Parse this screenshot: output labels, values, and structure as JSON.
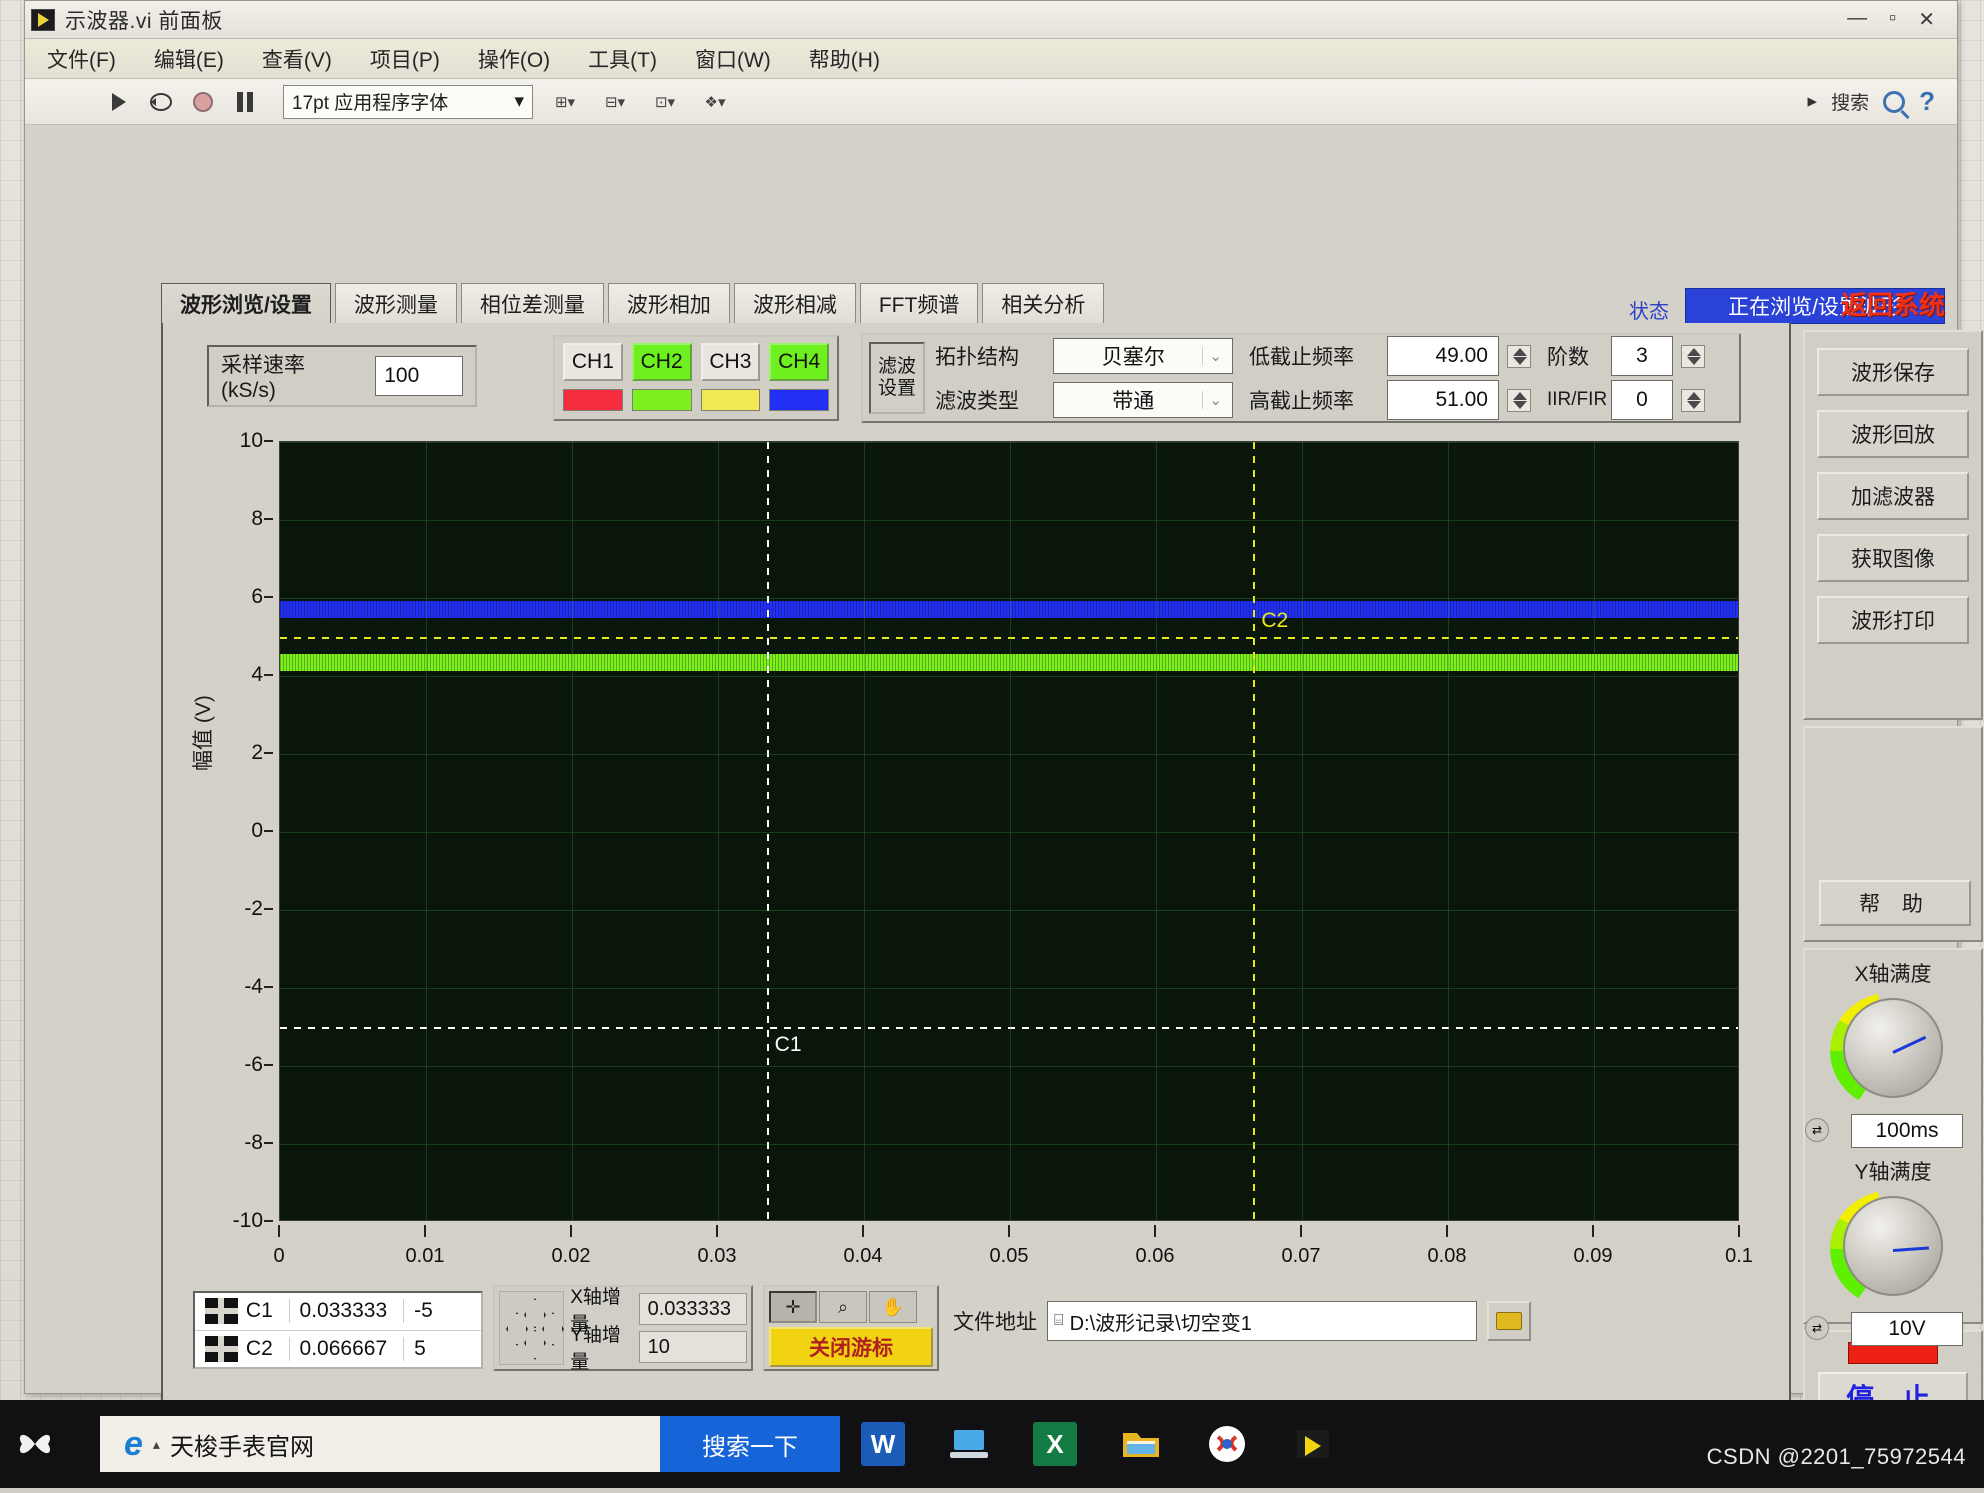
{
  "window": {
    "title": "示波器.vi 前面板",
    "controls": {
      "minimize": "—",
      "maximize": "▫",
      "close": "✕"
    }
  },
  "menu": [
    "文件(F)",
    "编辑(E)",
    "查看(V)",
    "项目(P)",
    "操作(O)",
    "工具(T)",
    "窗口(W)",
    "帮助(H)"
  ],
  "toolbar": {
    "font_selector": "17pt 应用程序字体",
    "search_placeholder": "搜索"
  },
  "tabs": [
    {
      "label": "波形浏览/设置",
      "active": true
    },
    {
      "label": "波形测量",
      "active": false
    },
    {
      "label": "相位差测量",
      "active": false
    },
    {
      "label": "波形相加",
      "active": false
    },
    {
      "label": "波形相减",
      "active": false
    },
    {
      "label": "FFT频谱",
      "active": false
    },
    {
      "label": "相关分析",
      "active": false
    }
  ],
  "status": {
    "label": "状态",
    "value": "正在浏览/设置波形",
    "color": "#2b42d8"
  },
  "sample_rate": {
    "label": "采样速率 (kS/s)",
    "value": "100"
  },
  "channels": {
    "buttons": [
      {
        "label": "CH1",
        "active": false,
        "color": "#f52b3e"
      },
      {
        "label": "CH2",
        "active": true,
        "color": "#7cf01c"
      },
      {
        "label": "CH3",
        "active": false,
        "color": "#f2ea52"
      },
      {
        "label": "CH4",
        "active": true,
        "color": "#2230f5"
      }
    ]
  },
  "filter": {
    "tag_line1": "滤波",
    "tag_line2": "设置",
    "topology_label": "拓扑结构",
    "topology_value": "贝塞尔",
    "type_label": "滤波类型",
    "type_value": "带通",
    "low_cut_label": "低截止频率",
    "low_cut_value": "49.00",
    "high_cut_label": "高截止频率",
    "high_cut_value": "51.00",
    "order_label": "阶数",
    "order_value": "3",
    "iirfir_label": "IIR/FIR",
    "iirfir_value": "0"
  },
  "chart_data": {
    "type": "line",
    "title": "",
    "xlabel": "",
    "ylabel": "幅值 (V)",
    "x": [
      0,
      0.01,
      0.02,
      0.03,
      0.04,
      0.05,
      0.06,
      0.07,
      0.08,
      0.09,
      0.1
    ],
    "xticks": [
      "0",
      "0.01",
      "0.02",
      "0.03",
      "0.04",
      "0.05",
      "0.06",
      "0.07",
      "0.08",
      "0.09",
      "0.1"
    ],
    "yticks": [
      "10",
      "8",
      "6",
      "4",
      "2",
      "0",
      "-2",
      "-4",
      "-6",
      "-8",
      "-10"
    ],
    "xlim": [
      0,
      0.1
    ],
    "ylim": [
      -10,
      10
    ],
    "grid": true,
    "background": "#0b160b",
    "series": [
      {
        "name": "CH4",
        "color": "#2230f5",
        "mean": 5.7,
        "noise_band": 0.45,
        "values": [
          5.7,
          5.7,
          5.7,
          5.7,
          5.7,
          5.7,
          5.7,
          5.7,
          5.7,
          5.7,
          5.7
        ]
      },
      {
        "name": "CH2",
        "color": "#7cf01c",
        "mean": 4.35,
        "noise_band": 0.45,
        "values": [
          4.35,
          4.35,
          4.35,
          4.35,
          4.35,
          4.35,
          4.35,
          4.35,
          4.35,
          4.35,
          4.35
        ]
      }
    ],
    "cursors": [
      {
        "name": "C1",
        "x": 0.033333,
        "y": -5,
        "color": "#ffffff"
      },
      {
        "name": "C2",
        "x": 0.066667,
        "y": 5,
        "color": "#e8e81e"
      }
    ]
  },
  "cursor_table": {
    "rows": [
      {
        "name": "C1",
        "x": "0.033333",
        "y": "-5"
      },
      {
        "name": "C2",
        "x": "0.066667",
        "y": "5"
      }
    ]
  },
  "increments": {
    "x_label": "X轴增量",
    "x_value": "0.033333",
    "y_label": "Y轴增量",
    "y_value": "10"
  },
  "graph_palette": {
    "icons": [
      "cursor-crosshair-icon",
      "zoom-icon",
      "pan-hand-icon"
    ],
    "toggle_label": "关闭游标"
  },
  "file": {
    "label": "文件地址",
    "path": "D:\\波形记录\\切空变1"
  },
  "sidebar": {
    "title": "返回系统",
    "buttons": [
      "波形保存",
      "波形回放",
      "加滤波器",
      "获取图像",
      "波形打印"
    ],
    "help_label": "帮 助",
    "x_scale": {
      "label": "X轴满度",
      "value": "100ms"
    },
    "y_scale": {
      "label": "Y轴满度",
      "value": "10V"
    },
    "stop_label": "停 止"
  },
  "taskbar": {
    "search_value": "天梭手表官网",
    "search_button": "搜索一下",
    "apps": [
      "word-icon",
      "display-icon",
      "excel-icon",
      "folder-icon",
      "wps-cloud-icon",
      "labview-icon"
    ],
    "watermark": "CSDN @2201_75972544"
  }
}
